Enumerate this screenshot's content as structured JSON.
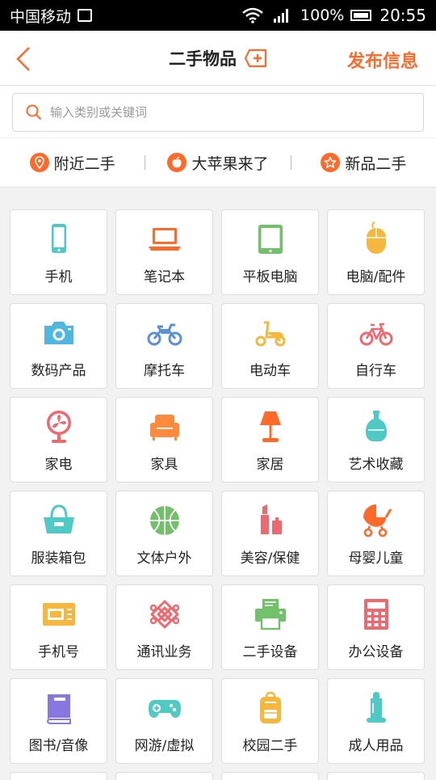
{
  "status_bar": {
    "carrier": "中国移动",
    "battery": "100%",
    "time": "20:55"
  },
  "header": {
    "title": "二手物品",
    "publish_label": "发布信息"
  },
  "search": {
    "placeholder": "输入类别或关键词"
  },
  "quick_links": [
    {
      "label": "附近二手",
      "icon": "location-icon"
    },
    {
      "label": "大苹果来了",
      "icon": "apple-icon"
    },
    {
      "label": "新品二手",
      "icon": "star-icon"
    }
  ],
  "colors": {
    "accent": "#ff6a2b",
    "teal": "#4fc9c3",
    "green": "#72c06a",
    "blue": "#5b8fd8",
    "pink": "#f0686f",
    "yellow": "#f6b73c",
    "purple": "#8877e0"
  },
  "categories": [
    {
      "label": "手机",
      "icon": "phone-icon"
    },
    {
      "label": "笔记本",
      "icon": "laptop-icon"
    },
    {
      "label": "平板电脑",
      "icon": "tablet-icon"
    },
    {
      "label": "电脑/配件",
      "icon": "mouse-icon"
    },
    {
      "label": "数码产品",
      "icon": "camera-icon"
    },
    {
      "label": "摩托车",
      "icon": "motorcycle-icon"
    },
    {
      "label": "电动车",
      "icon": "scooter-icon"
    },
    {
      "label": "自行车",
      "icon": "bicycle-icon"
    },
    {
      "label": "家电",
      "icon": "fan-icon"
    },
    {
      "label": "家具",
      "icon": "sofa-icon"
    },
    {
      "label": "家居",
      "icon": "lamp-icon"
    },
    {
      "label": "艺术收藏",
      "icon": "vase-icon"
    },
    {
      "label": "服装箱包",
      "icon": "bag-icon"
    },
    {
      "label": "文体户外",
      "icon": "ball-icon"
    },
    {
      "label": "美容/保健",
      "icon": "lipstick-icon"
    },
    {
      "label": "母婴儿童",
      "icon": "stroller-icon"
    },
    {
      "label": "手机号",
      "icon": "sim-card-icon"
    },
    {
      "label": "通讯业务",
      "icon": "telecom-knot-icon"
    },
    {
      "label": "二手设备",
      "icon": "printer-icon"
    },
    {
      "label": "办公设备",
      "icon": "calculator-icon"
    },
    {
      "label": "图书/音像",
      "icon": "book-icon"
    },
    {
      "label": "网游/虚拟",
      "icon": "gamepad-icon"
    },
    {
      "label": "校园二手",
      "icon": "backpack-icon"
    },
    {
      "label": "成人用品",
      "icon": "condom-icon"
    }
  ]
}
